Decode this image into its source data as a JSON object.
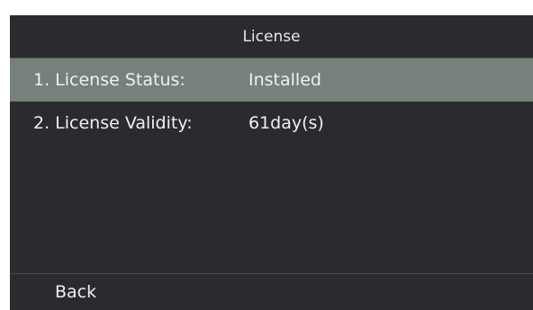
{
  "screen": {
    "title": "License"
  },
  "items": [
    {
      "label": "1. License Status:",
      "value": "Installed",
      "selected": true
    },
    {
      "label": "2. License Validity:",
      "value": "61day(s)",
      "selected": false
    }
  ],
  "softkeys": {
    "back_label": "Back"
  },
  "colors": {
    "background": "#2b2a2f",
    "selected_row": "#77807a",
    "text": "#f0f0f0",
    "divider": "#4a4a4e"
  }
}
